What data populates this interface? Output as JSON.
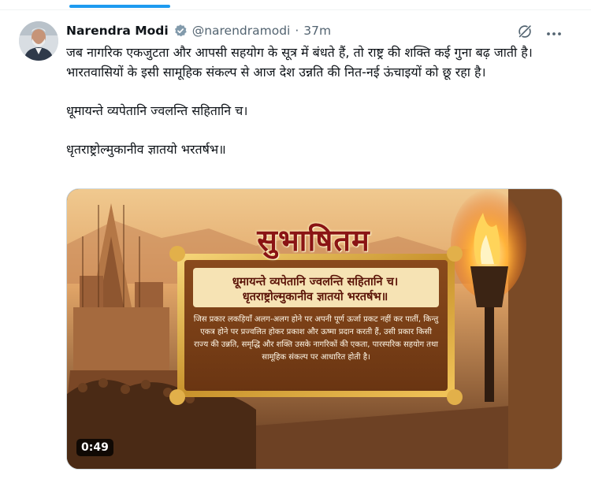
{
  "author": {
    "name": "Narendra Modi",
    "handle": "@narendramodi",
    "separator": "·",
    "time": "37m"
  },
  "tweet": {
    "lines": [
      "जब नागरिक एकजुटता और आपसी सहयोग के सूत्र में बंधते हैं, तो राष्ट्र की शक्ति कई गुना बढ़ जाती है। भारतवासियों के इसी सामूहिक संकल्प से आज देश उन्नति की नित-नई ऊंचाइयों को छू रहा है।",
      "धूमायन्ते व्यपेतानि ज्वलन्ति सहितानि च।",
      "धृतराष्ट्रोल्मुकानीव ज्ञातयो भरतर्षभ॥"
    ]
  },
  "media": {
    "title": "सुभाषितम",
    "verse_line1": "धूमायन्ते व्यपेतानि ज्वलन्ति सहितानि च।",
    "verse_line2": "धृतराष्ट्रोल्मुकानीव ज्ञातयो भरतर्षभ॥",
    "meaning": "जिस प्रकार लकड़ियाँ अलग-अलग होने पर अपनी पूर्ण ऊर्जा प्रकट नहीं कर पातीं, किन्तु एकत्र होने पर प्रज्वलित होकर प्रकाश और ऊष्मा प्रदान करती हैं, उसी प्रकार किसी राज्य की उन्नति, समृद्धि और शक्ति उसके नागरिकों की एकता, पारस्परिक सहयोग तथा सामूहिक संकल्प पर आधारित होती है।",
    "duration": "0:49"
  },
  "icons": {
    "verified": "verified-badge-icon",
    "grok": "grok-icon",
    "more": "more-icon"
  },
  "colors": {
    "accent": "#1d9bf0",
    "text": "#0f1419",
    "secondary": "#536471",
    "title_red": "#8a1414"
  }
}
